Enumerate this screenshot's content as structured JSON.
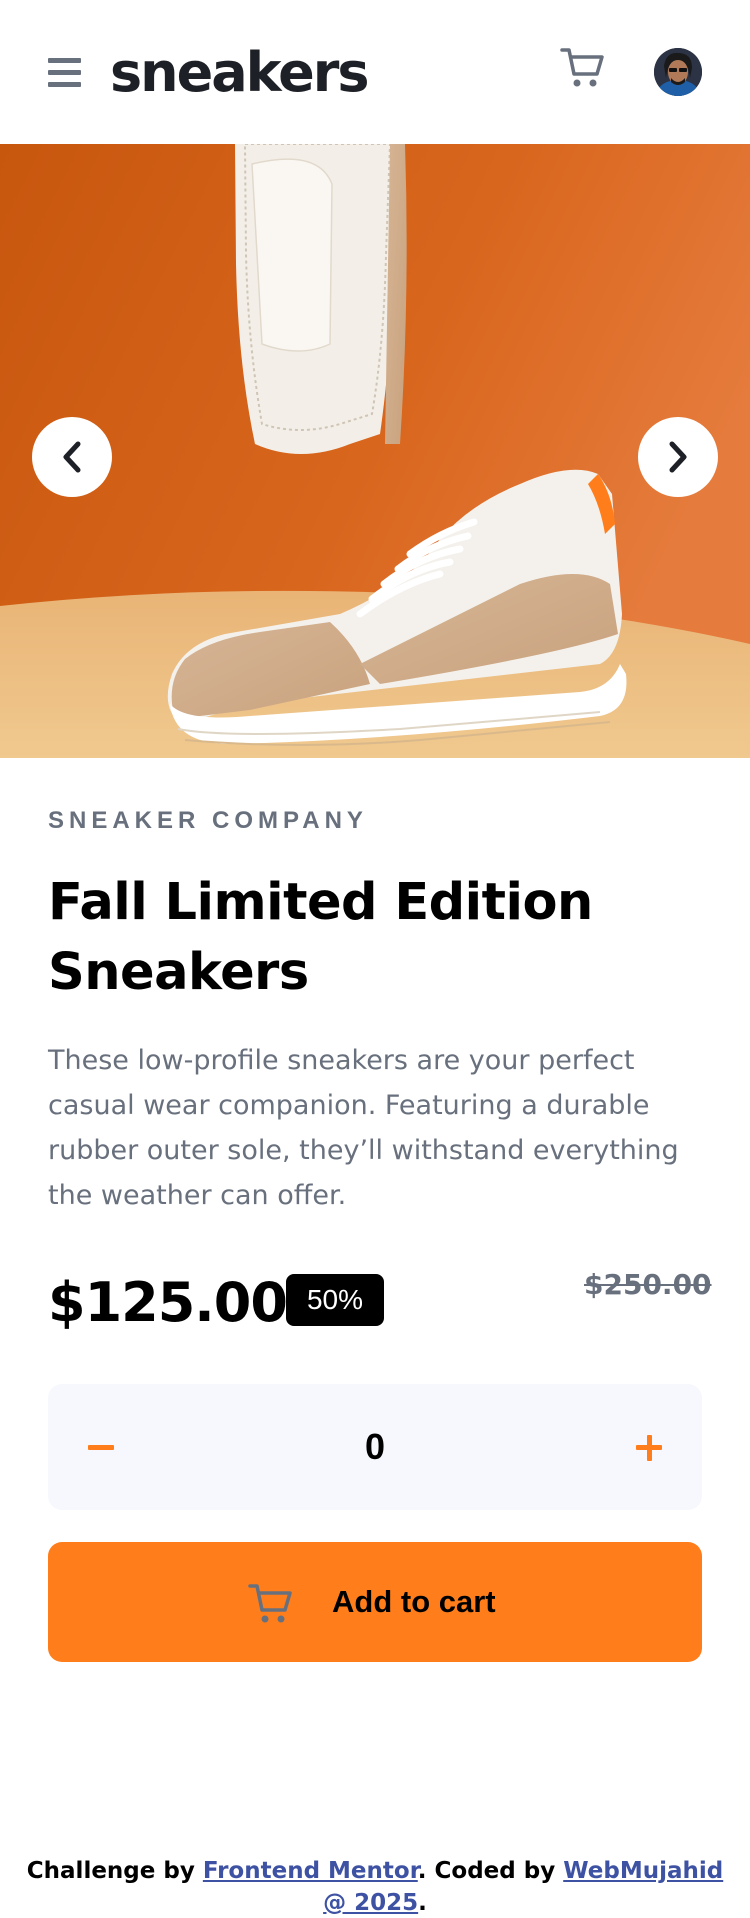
{
  "header": {
    "logo": "sneakers",
    "menu_icon": "hamburger-menu-icon",
    "cart_icon": "cart-icon",
    "avatar_icon": "user-avatar"
  },
  "gallery": {
    "prev_icon": "chevron-left-icon",
    "next_icon": "chevron-right-icon"
  },
  "product": {
    "company": "SNEAKER COMPANY",
    "title": "Fall Limited Edition Sneakers",
    "description": "These low-profile sneakers are your perfect casual wear companion. Featuring a durable rubber outer sole, they’ll withstand everything the weather can offer.",
    "price": "$125.00",
    "discount": "50%",
    "original_price": "$250.00"
  },
  "quantity": {
    "value": "0",
    "minus_icon": "minus-icon",
    "plus_icon": "plus-icon"
  },
  "add_to_cart": {
    "label": "Add to cart",
    "icon": "cart-icon"
  },
  "footer": {
    "text_before": "Challenge by ",
    "link1": "Frontend Mentor",
    "text_middle": ". Coded by ",
    "link2": "WebMujahid @ 2025",
    "text_after": "."
  },
  "colors": {
    "accent": "#ff7e1b",
    "dark": "#1d2026",
    "muted": "#68707d",
    "light_bg": "#f6f8fd",
    "link": "#3e52a3"
  }
}
